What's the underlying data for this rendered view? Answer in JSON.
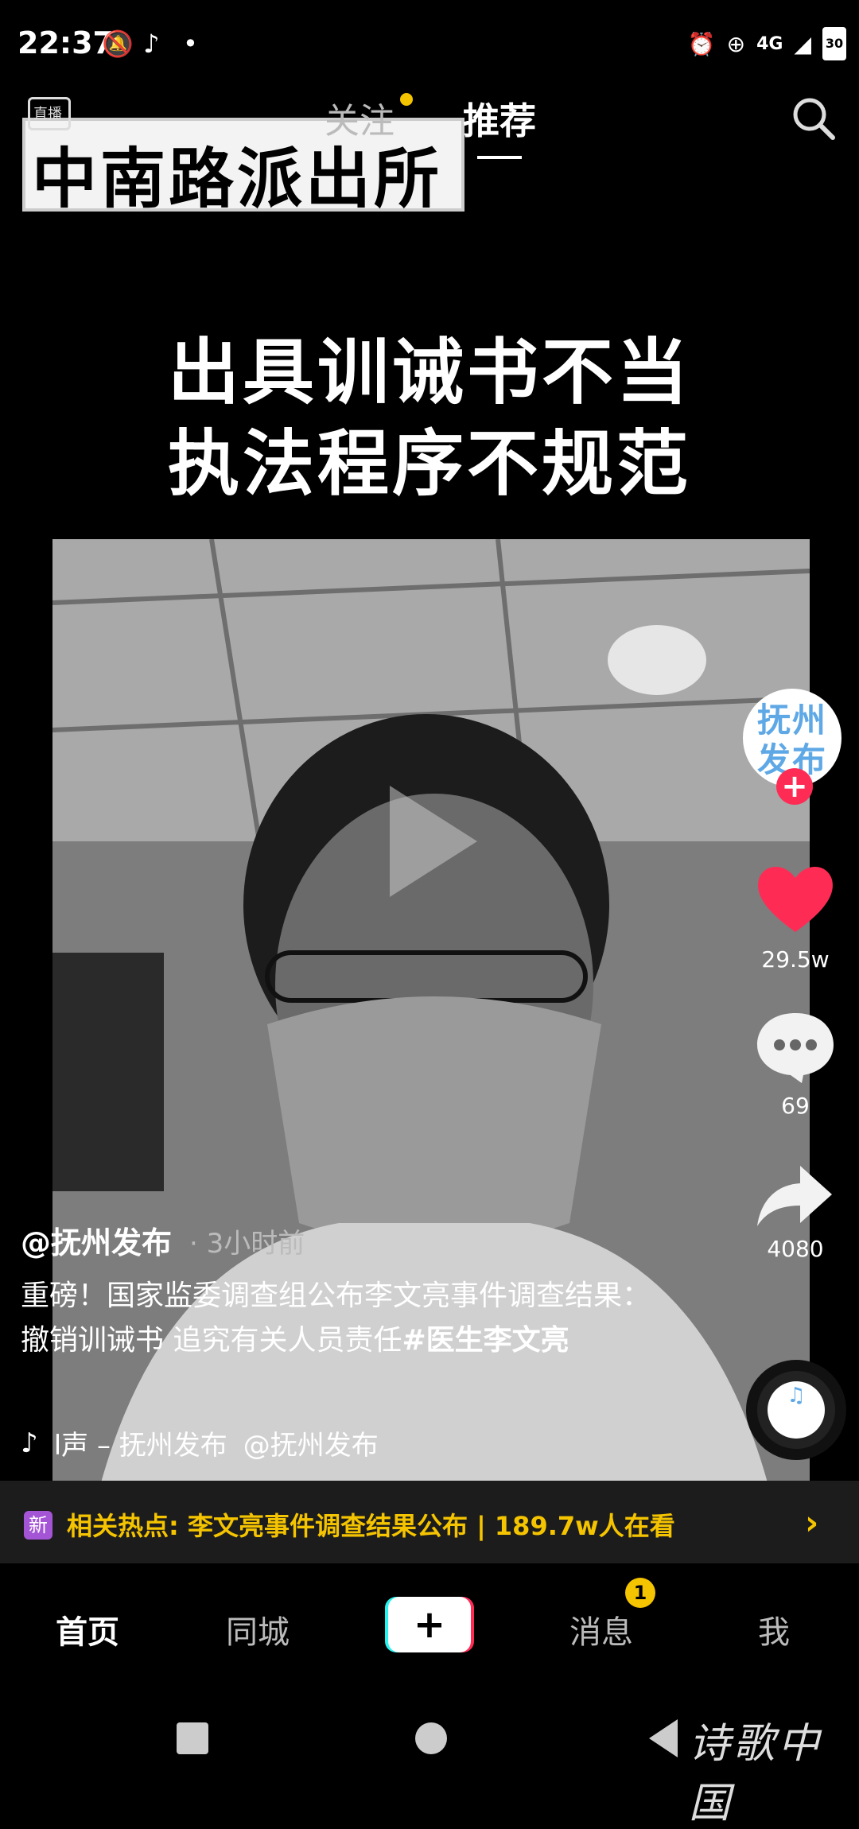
{
  "status_bar": {
    "time": "22:37",
    "network": "4G",
    "battery": "30"
  },
  "top_nav": {
    "live_label": "直播",
    "tab_follow": "关注",
    "tab_recommend": "推荐"
  },
  "video": {
    "caption": "中南路派出所",
    "headline_line1": "出具训诫书不当",
    "headline_line2": "执法程序不规范"
  },
  "post": {
    "author": "@抚州发布",
    "time": "· 3小时前",
    "description": "重磅！国家监委调查组公布李文亮事件调查结果：撤销训诫书 追究有关人员责任",
    "hashtag": "#医生李文亮",
    "music": "l声 – 抚州发布",
    "music_author": "@抚州发布"
  },
  "actions": {
    "avatar_text": "抚州发布",
    "likes": "29.5w",
    "comments": "69",
    "shares": "4080"
  },
  "hot_topic": {
    "badge": "新",
    "text": "相关热点: 李文亮事件调查结果公布 | 189.7w人在看"
  },
  "bottom_nav": {
    "home": "首页",
    "city": "同城",
    "create": "+",
    "message": "消息",
    "message_badge": "1",
    "me": "我"
  },
  "watermark": "诗歌中国",
  "colors": {
    "accent_red": "#fe2c55",
    "accent_cyan": "#25f4ee",
    "hot_yellow": "#f5c400"
  }
}
